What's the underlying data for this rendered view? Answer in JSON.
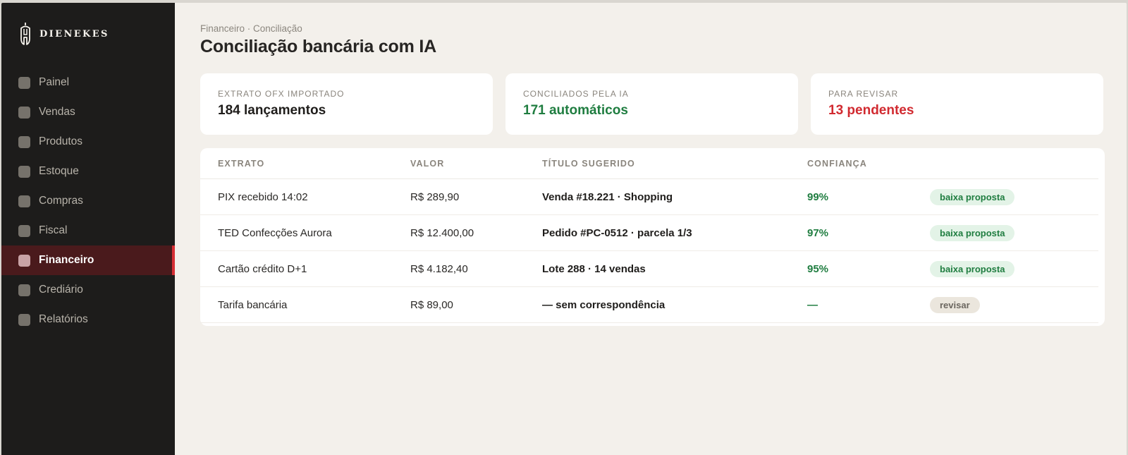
{
  "brand": {
    "name": "DIENEKES",
    "logo_icon": "helmet-icon"
  },
  "sidebar": {
    "items": [
      {
        "label": "Painel",
        "active": false
      },
      {
        "label": "Vendas",
        "active": false
      },
      {
        "label": "Produtos",
        "active": false
      },
      {
        "label": "Estoque",
        "active": false
      },
      {
        "label": "Compras",
        "active": false
      },
      {
        "label": "Fiscal",
        "active": false
      },
      {
        "label": "Financeiro",
        "active": true
      },
      {
        "label": "Crediário",
        "active": false
      },
      {
        "label": "Relatórios",
        "active": false
      }
    ]
  },
  "header": {
    "breadcrumb": "Financeiro · Conciliação",
    "title": "Conciliação bancária com IA"
  },
  "kpis": [
    {
      "label": "EXTRATO OFX IMPORTADO",
      "value": "184 lançamentos",
      "tone": "default"
    },
    {
      "label": "CONCILIADOS PELA IA",
      "value": "171 automáticos",
      "tone": "green"
    },
    {
      "label": "PARA REVISAR",
      "value": "13 pendentes",
      "tone": "red"
    }
  ],
  "table": {
    "columns": [
      "EXTRATO",
      "VALOR",
      "TÍTULO SUGERIDO",
      "CONFIANÇA"
    ],
    "rows": [
      {
        "extrato": "PIX recebido 14:02",
        "valor": "R$ 289,90",
        "titulo": "Venda #18.221 · Shopping",
        "confianca": "99%",
        "acao": "baixa proposta",
        "acao_tipo": "ok"
      },
      {
        "extrato": "TED Confecções Aurora",
        "valor": "R$ 12.400,00",
        "titulo": "Pedido #PC-0512 · parcela 1/3",
        "confianca": "97%",
        "acao": "baixa proposta",
        "acao_tipo": "ok"
      },
      {
        "extrato": "Cartão crédito D+1",
        "valor": "R$ 4.182,40",
        "titulo": "Lote 288 · 14 vendas",
        "confianca": "95%",
        "acao": "baixa proposta",
        "acao_tipo": "ok"
      },
      {
        "extrato": "Tarifa bancária",
        "valor": "R$ 89,00",
        "titulo": "— sem correspondência",
        "confianca": "—",
        "acao": "revisar",
        "acao_tipo": "rev"
      }
    ]
  },
  "colors": {
    "accent": "#d62f35",
    "success": "#1f7d40",
    "danger": "#d12a30",
    "sidebar_bg": "#1d1c1b",
    "page_bg": "#f3f0eb"
  }
}
